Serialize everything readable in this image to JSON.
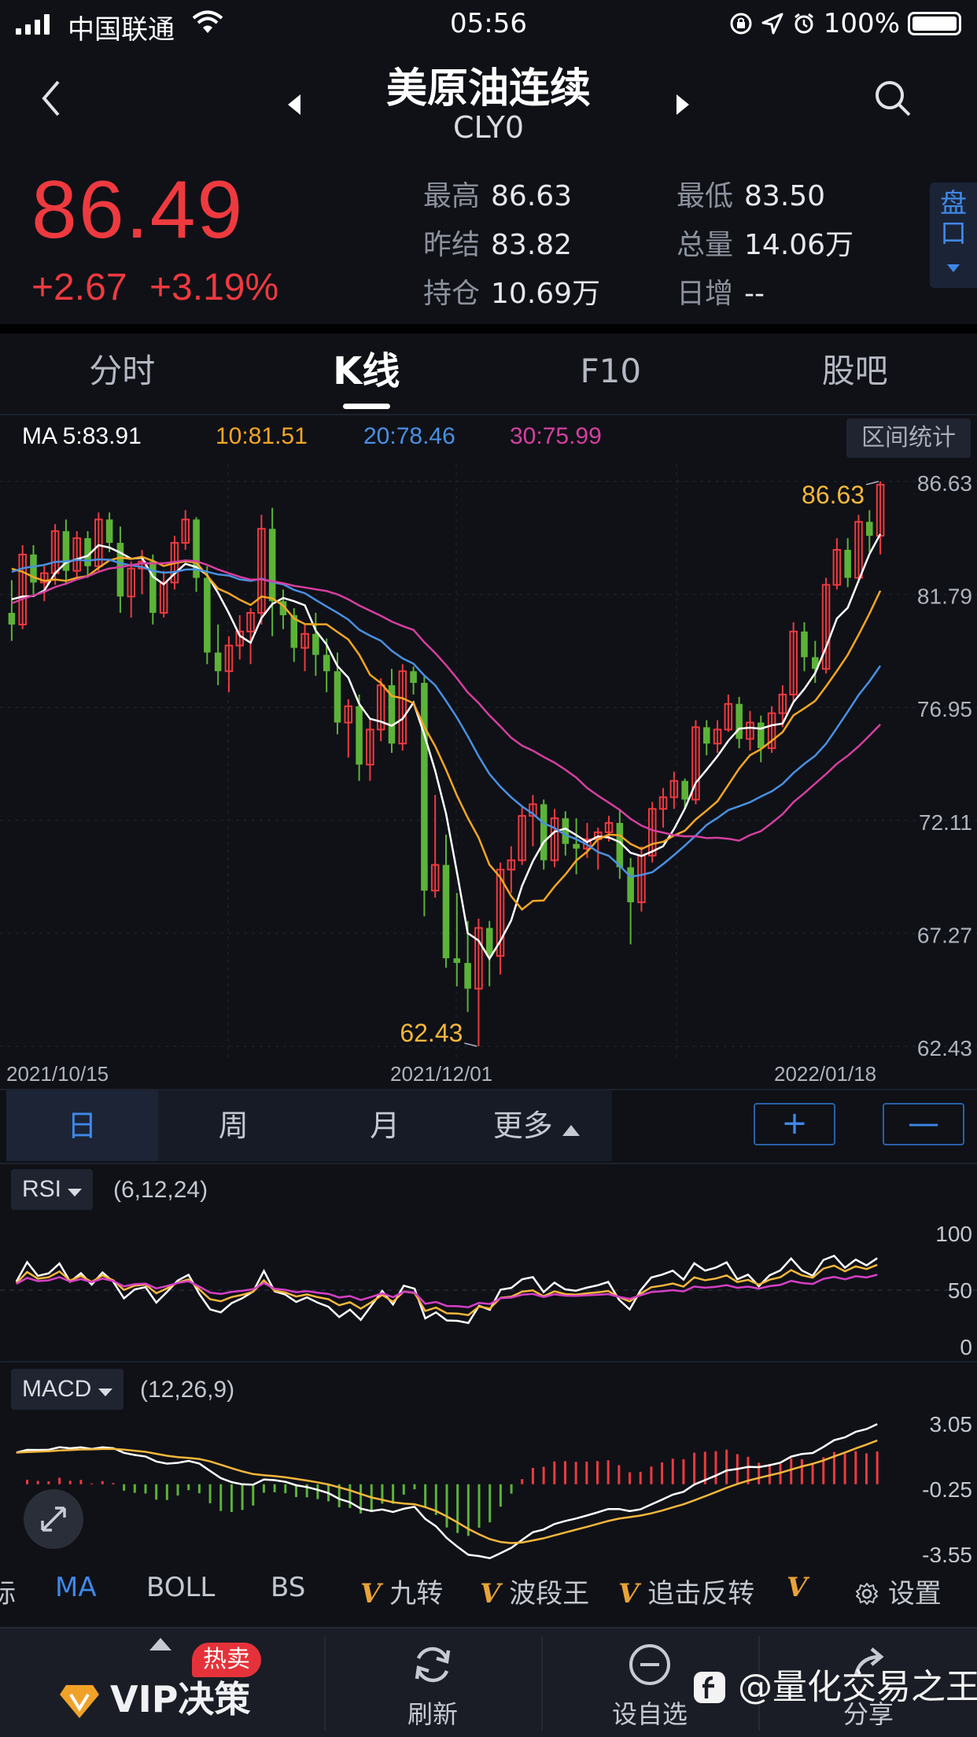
{
  "status": {
    "carrier": "中国联通",
    "time": "05:56",
    "battery": "100%"
  },
  "header": {
    "title": "美原油连续",
    "code": "CLY0"
  },
  "quote": {
    "price": "86.49",
    "change": "+2.67",
    "change_pct": "+3.19%",
    "high_label": "最高",
    "high": "86.63",
    "low_label": "最低",
    "low": "83.50",
    "prev_settle_label": "昨结",
    "prev_settle": "83.82",
    "volume_label": "总量",
    "volume": "14.06万",
    "open_interest_label": "持仓",
    "open_interest": "10.69万",
    "daily_inc_label": "日增",
    "daily_inc": "--",
    "pankou_label": "盘口",
    "up_color": "#ee3a3f",
    "down_color": "#5cb338"
  },
  "tabs": [
    "分时",
    "K线",
    "F10",
    "股吧"
  ],
  "ma_legend": {
    "ma5": "MA 5:83.91",
    "ma10": "10:81.51",
    "ma20": "20:78.46",
    "ma30": "30:75.99",
    "ma5_color": "#ffffff",
    "ma10_color": "#f5a623",
    "ma20_color": "#4a90e2",
    "ma30_color": "#d63fa0"
  },
  "range_button": "区间统计",
  "chart_data": [
    {
      "type": "candlestick",
      "title": "",
      "y_ticks": [
        "86.63",
        "81.79",
        "76.95",
        "72.11",
        "67.27",
        "62.43"
      ],
      "ylim": [
        62.43,
        86.63
      ],
      "x_ticks": [
        "2021/10/15",
        "2021/12/01",
        "2022/01/18"
      ],
      "annotations": {
        "max": "86.63",
        "min": "62.43"
      },
      "candles": [
        [
          81.0,
          82.4,
          79.8,
          80.5
        ],
        [
          80.5,
          83.9,
          80.3,
          83.5
        ],
        [
          83.5,
          83.9,
          81.8,
          82.3
        ],
        [
          82.3,
          83.0,
          81.5,
          82.7
        ],
        [
          82.7,
          84.8,
          82.2,
          84.5
        ],
        [
          84.5,
          85.0,
          82.2,
          82.8
        ],
        [
          82.8,
          84.5,
          82.5,
          84.2
        ],
        [
          84.2,
          84.5,
          82.5,
          83.0
        ],
        [
          83.0,
          85.3,
          82.8,
          85.0
        ],
        [
          85.0,
          85.3,
          83.6,
          84.0
        ],
        [
          84.0,
          84.7,
          81.0,
          81.7
        ],
        [
          81.7,
          83.2,
          80.8,
          82.9
        ],
        [
          82.9,
          83.7,
          81.8,
          83.2
        ],
        [
          83.2,
          83.5,
          80.5,
          81.0
        ],
        [
          81.0,
          82.8,
          80.8,
          82.3
        ],
        [
          82.3,
          84.3,
          82.0,
          84.0
        ],
        [
          84.0,
          85.4,
          83.7,
          85.0
        ],
        [
          85.0,
          85.1,
          81.9,
          82.5
        ],
        [
          82.5,
          83.0,
          78.8,
          79.3
        ],
        [
          79.3,
          80.5,
          77.9,
          78.5
        ],
        [
          78.5,
          80.0,
          77.6,
          79.6
        ],
        [
          79.6,
          80.9,
          79.0,
          80.2
        ],
        [
          80.2,
          81.2,
          78.8,
          81.0
        ],
        [
          81.0,
          85.2,
          80.5,
          84.6
        ],
        [
          84.6,
          85.5,
          80.0,
          81.5
        ],
        [
          81.5,
          82.0,
          80.3,
          80.9
        ],
        [
          80.9,
          81.2,
          78.9,
          79.5
        ],
        [
          79.5,
          80.5,
          78.5,
          80.1
        ],
        [
          80.1,
          81.0,
          78.3,
          79.2
        ],
        [
          79.2,
          79.9,
          77.6,
          78.5
        ],
        [
          78.5,
          79.3,
          75.8,
          76.3
        ],
        [
          76.3,
          77.3,
          74.8,
          77.0
        ],
        [
          77.0,
          77.5,
          73.8,
          74.5
        ],
        [
          74.5,
          76.5,
          73.8,
          76.0
        ],
        [
          76.0,
          78.2,
          75.5,
          77.9
        ],
        [
          77.9,
          78.6,
          75.0,
          75.4
        ],
        [
          75.4,
          78.8,
          75.1,
          78.5
        ],
        [
          78.5,
          78.7,
          77.5,
          78.0
        ],
        [
          78.0,
          78.3,
          68.0,
          69.1
        ],
        [
          69.1,
          73.2,
          68.8,
          70.2
        ],
        [
          70.2,
          71.5,
          65.8,
          66.2
        ],
        [
          66.2,
          69.0,
          65.0,
          66.0
        ],
        [
          66.0,
          67.8,
          63.9,
          64.9
        ],
        [
          64.9,
          67.9,
          62.43,
          67.5
        ],
        [
          67.5,
          67.8,
          65.0,
          66.3
        ],
        [
          66.3,
          70.3,
          65.5,
          70.0
        ],
        [
          70.0,
          71.0,
          69.0,
          70.4
        ],
        [
          70.4,
          72.7,
          70.2,
          72.3
        ],
        [
          72.3,
          73.2,
          71.0,
          72.8
        ],
        [
          72.8,
          73.0,
          70.0,
          70.4
        ],
        [
          70.4,
          72.6,
          70.1,
          72.2
        ],
        [
          72.2,
          72.5,
          70.6,
          71.1
        ],
        [
          71.1,
          72.2,
          69.8,
          70.9
        ],
        [
          70.9,
          72.0,
          70.5,
          71.3
        ],
        [
          71.3,
          71.8,
          70.0,
          71.6
        ],
        [
          71.6,
          72.3,
          71.2,
          72.0
        ],
        [
          72.0,
          72.6,
          69.6,
          70.1
        ],
        [
          70.1,
          70.5,
          66.8,
          68.6
        ],
        [
          68.6,
          71.0,
          68.2,
          70.6
        ],
        [
          70.6,
          72.9,
          70.3,
          72.6
        ],
        [
          72.6,
          73.5,
          71.8,
          73.1
        ],
        [
          73.1,
          74.2,
          72.6,
          73.8
        ],
        [
          73.8,
          73.9,
          72.6,
          73.0
        ],
        [
          73.0,
          76.4,
          72.8,
          76.1
        ],
        [
          76.1,
          76.4,
          74.9,
          75.4
        ],
        [
          75.4,
          76.4,
          75.0,
          76.0
        ],
        [
          76.0,
          77.5,
          75.9,
          77.1
        ],
        [
          77.1,
          77.4,
          75.2,
          75.6
        ],
        [
          75.6,
          76.8,
          75.1,
          76.3
        ],
        [
          76.3,
          76.6,
          74.6,
          75.2
        ],
        [
          75.2,
          77.0,
          75.0,
          76.7
        ],
        [
          76.7,
          77.9,
          76.1,
          77.5
        ],
        [
          77.5,
          80.6,
          77.2,
          80.2
        ],
        [
          80.2,
          80.6,
          78.5,
          79.1
        ],
        [
          79.1,
          79.8,
          78.0,
          78.6
        ],
        [
          78.6,
          82.5,
          78.4,
          82.2
        ],
        [
          82.2,
          84.2,
          82.0,
          83.7
        ],
        [
          83.7,
          84.2,
          82.1,
          82.5
        ],
        [
          82.5,
          85.2,
          82.3,
          84.9
        ],
        [
          84.9,
          85.4,
          83.6,
          84.3
        ],
        [
          84.3,
          86.63,
          83.5,
          86.49
        ]
      ],
      "ma_series": [
        "MA5",
        "MA10",
        "MA20",
        "MA30"
      ]
    },
    {
      "type": "line",
      "name": "RSI",
      "params": "(6,12,24)",
      "y_ticks": [
        "100",
        "50",
        "0"
      ],
      "ylim": [
        0,
        100
      ]
    },
    {
      "type": "bar+line",
      "name": "MACD",
      "params": "(12,26,9)",
      "y_ticks": [
        "3.05",
        "-0.25",
        "-3.55"
      ],
      "ylim": [
        -3.55,
        3.05
      ]
    }
  ],
  "periods": [
    "日",
    "周",
    "月",
    "更多"
  ],
  "zoom": {
    "plus": "+",
    "minus": "—"
  },
  "indicators": {
    "rsi_label": "RSI",
    "rsi_params": "(6,12,24)",
    "macd_label": "MACD",
    "macd_params": "(12,26,9)"
  },
  "indicator_strip": {
    "i0": "标",
    "i1": "MA",
    "i2": "BOLL",
    "i3": "BS",
    "i4": "九转",
    "i5": "波段王",
    "i6": "追击反转",
    "i7": "设置",
    "v_mark": "V"
  },
  "bottom": {
    "vip": "VIP决策",
    "hot": "热卖",
    "refresh": "刷新",
    "watchlist": "设自选",
    "share": "分享",
    "watermark": "@量化交易之王"
  }
}
